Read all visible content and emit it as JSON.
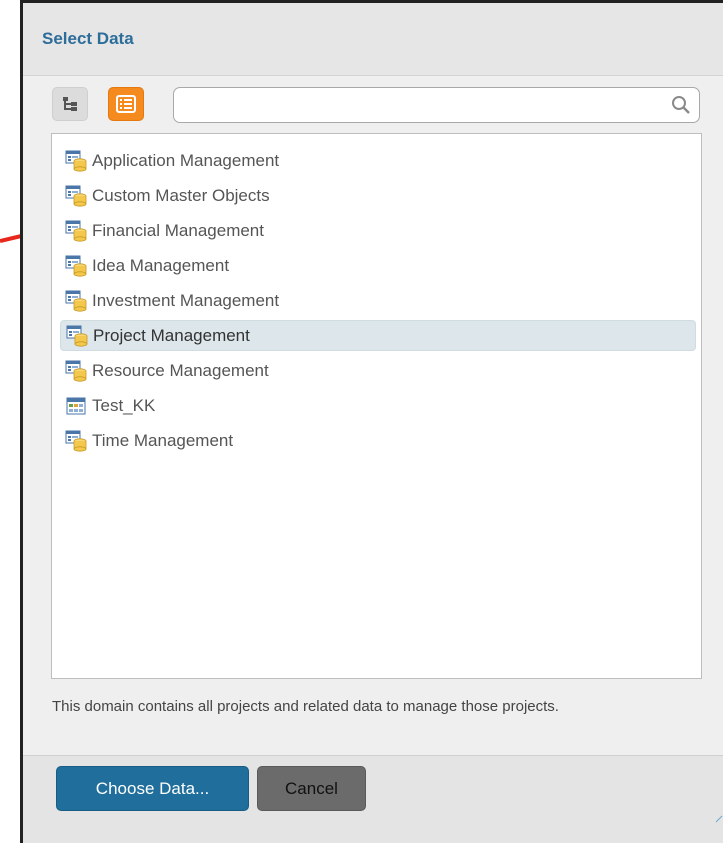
{
  "dialog": {
    "title": "Select Data"
  },
  "toolbar": {
    "tree_view_icon": "tree-view-icon",
    "list_view_icon": "list-view-icon",
    "active_view": "list",
    "search": {
      "value": "",
      "placeholder": ""
    }
  },
  "domains": [
    {
      "label": "Application Management",
      "icon": "domain-database-icon",
      "selected": false
    },
    {
      "label": "Custom Master Objects",
      "icon": "domain-database-icon",
      "selected": false
    },
    {
      "label": "Financial Management",
      "icon": "domain-database-icon",
      "selected": false
    },
    {
      "label": "Idea Management",
      "icon": "domain-database-icon",
      "selected": false
    },
    {
      "label": "Investment Management",
      "icon": "domain-database-icon",
      "selected": false
    },
    {
      "label": "Project Management",
      "icon": "domain-database-icon",
      "selected": true
    },
    {
      "label": "Resource Management",
      "icon": "domain-database-icon",
      "selected": false
    },
    {
      "label": "Test_KK",
      "icon": "table-icon",
      "selected": false
    },
    {
      "label": "Time Management",
      "icon": "domain-database-icon",
      "selected": false
    }
  ],
  "description": "This domain contains all projects and related data to manage those projects.",
  "buttons": {
    "choose": "Choose Data...",
    "cancel": "Cancel"
  },
  "colors": {
    "title": "#2d6d99",
    "accent_orange": "#f58a1f",
    "primary_button": "#1f6e9b",
    "secondary_button": "#6b6b6b",
    "selected_row": "#dde6ea",
    "annotation_arrow": "#e8281c"
  }
}
